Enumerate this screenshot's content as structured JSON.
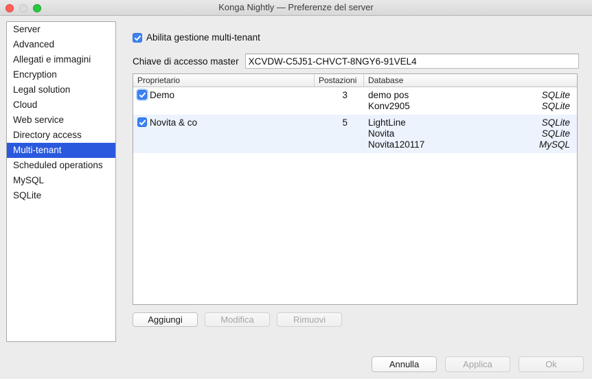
{
  "window": {
    "title": "Konga Nightly — Preferenze del server",
    "controls": {
      "close": "close-button",
      "minimize": "minimize-button",
      "zoom": "zoom-button"
    },
    "accent_color": "#2b59de",
    "checkbox_color": "#3b82f6"
  },
  "sidebar": {
    "items": [
      {
        "label": "Server",
        "selected": false
      },
      {
        "label": "Advanced",
        "selected": false
      },
      {
        "label": "Allegati e immagini",
        "selected": false
      },
      {
        "label": "Encryption",
        "selected": false
      },
      {
        "label": "Legal solution",
        "selected": false
      },
      {
        "label": "Cloud",
        "selected": false
      },
      {
        "label": "Web service",
        "selected": false
      },
      {
        "label": "Directory access",
        "selected": false
      },
      {
        "label": "Multi-tenant",
        "selected": true
      },
      {
        "label": "Scheduled operations",
        "selected": false
      },
      {
        "label": "MySQL",
        "selected": false
      },
      {
        "label": "SQLite",
        "selected": false
      }
    ]
  },
  "main": {
    "enable_multitenant": {
      "label": "Abilita gestione multi-tenant",
      "checked": true
    },
    "master_key": {
      "label": "Chiave di accesso master",
      "value": "XCVDW-C5J51-CHVCT-8NGY6-91VEL4"
    },
    "table": {
      "headers": {
        "owner": "Proprietario",
        "seats": "Postazioni",
        "database": "Database"
      },
      "rows": [
        {
          "checked": true,
          "owner": "Demo",
          "seats": "3",
          "databases": [
            {
              "name": "demo pos",
              "type": "SQLite"
            },
            {
              "name": "Konv2905",
              "type": "SQLite"
            }
          ]
        },
        {
          "checked": true,
          "owner": "Novita & co",
          "seats": "5",
          "databases": [
            {
              "name": "LightLine",
              "type": "SQLite"
            },
            {
              "name": "Novita",
              "type": "SQLite"
            },
            {
              "name": "Novita120117",
              "type": "MySQL"
            }
          ]
        }
      ]
    },
    "row_actions": {
      "add": {
        "label": "Aggiungi",
        "enabled": true
      },
      "edit": {
        "label": "Modifica",
        "enabled": false
      },
      "remove": {
        "label": "Rimuovi",
        "enabled": false
      }
    }
  },
  "footer": {
    "cancel": {
      "label": "Annulla",
      "enabled": true
    },
    "apply": {
      "label": "Applica",
      "enabled": false
    },
    "ok": {
      "label": "Ok",
      "enabled": false
    }
  }
}
